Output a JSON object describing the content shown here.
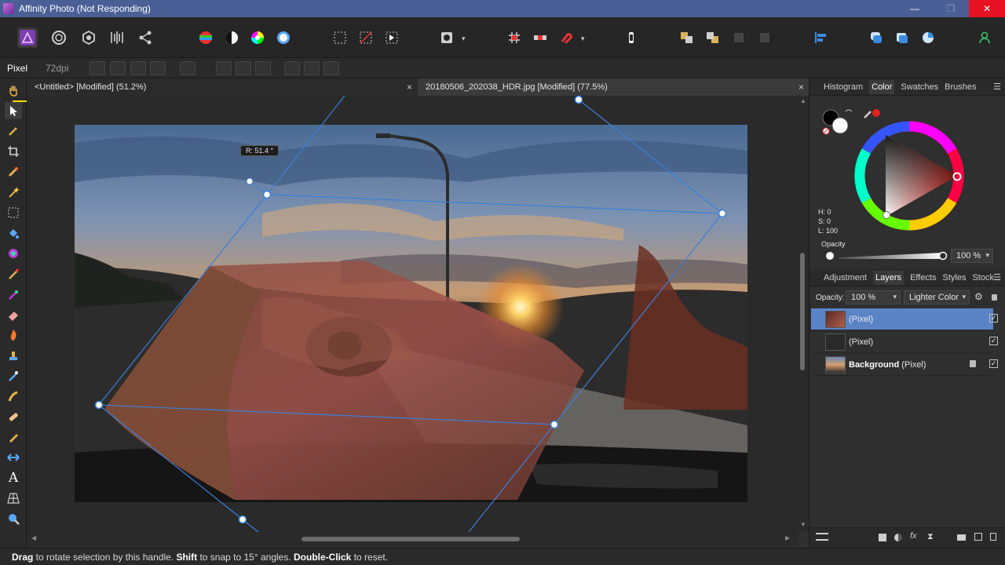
{
  "window": {
    "title": "Affinity Photo (Not Responding)",
    "minimize": "—",
    "maximize": "❐",
    "close": "✕"
  },
  "context_toolbar": {
    "persona": "Pixel",
    "dpi": "72dpi"
  },
  "tabs": [
    {
      "label": "<Untitled> [Modified] (51.2%)",
      "close": "×"
    },
    {
      "label": "20180506_202038_HDR.jpg [Modified] (77.5%)",
      "close": "×"
    }
  ],
  "canvas": {
    "rotation_readout": "R: 51.4 °"
  },
  "color_panel": {
    "tabs": [
      "Histogram",
      "Color",
      "Swatches",
      "Brushes"
    ],
    "active_tab": "Color",
    "h": "H: 0",
    "s": "S: 0",
    "l": "L: 100",
    "opacity_label": "Opacity",
    "opacity_value": "100 %",
    "fill_color": "#000000",
    "stroke_color": "#ffffff",
    "hue_accent": "#e0241c"
  },
  "layers_panel": {
    "tabs": [
      "Adjustment",
      "Layers",
      "Effects",
      "Styles",
      "Stock"
    ],
    "active_tab": "Layers",
    "opacity_label": "Opacity:",
    "opacity_value": "100 %",
    "blend_mode": "Lighter Color",
    "layers": [
      {
        "name": "(Pixel)",
        "bold": "",
        "selected": true,
        "checked": "✓"
      },
      {
        "name": "(Pixel)",
        "bold": "",
        "selected": false,
        "checked": "✓"
      },
      {
        "name": "(Pixel)",
        "bold": "Background",
        "selected": false,
        "checked": "✓"
      }
    ]
  },
  "statusbar": {
    "w1": "Drag",
    "t1": " to rotate selection by this handle. ",
    "w2": "Shift",
    "t2": " to snap to 15° angles. ",
    "w3": "Double-Click",
    "t3": " to reset."
  },
  "colors": {
    "titlebar": "#4a5f95",
    "accent_selection": "#5b84c7",
    "handle_blue": "#3c7fd8",
    "untitled_tab_underline": "#f5e000",
    "hdr_tab_underline": "#f07a1a"
  },
  "icons": {
    "persona_photo": "affinity-photo-persona-icon",
    "liquify": "liquify-persona-icon",
    "develop": "develop-persona-icon",
    "tone_mapping": "tone-mapping-persona-icon",
    "export": "export-persona-icon",
    "move_tool": "move-tool-icon",
    "hand_tool": "hand-tool-icon"
  }
}
